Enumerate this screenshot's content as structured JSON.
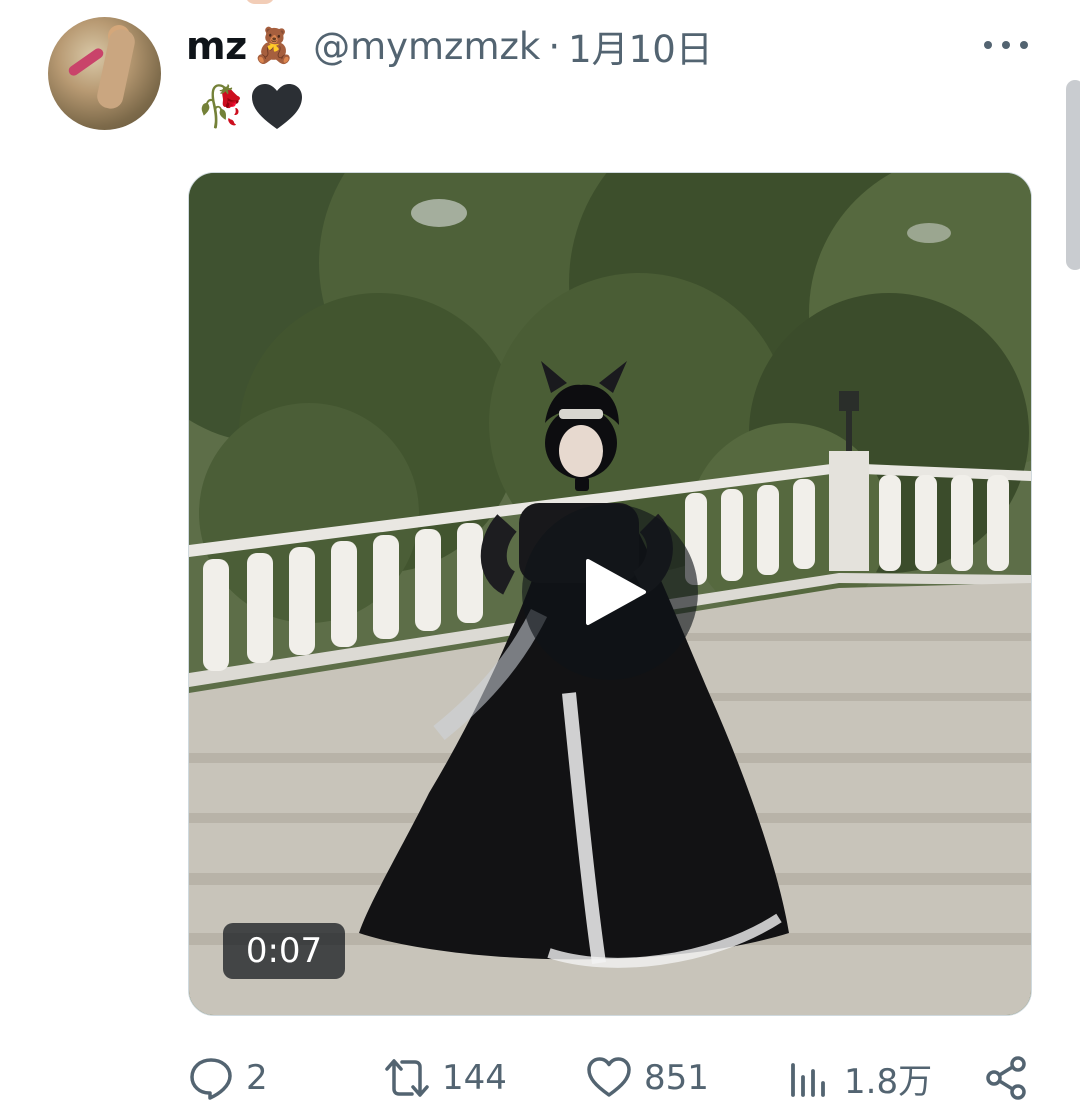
{
  "tweet": {
    "display_name": "mz",
    "name_emoji": "🧸",
    "handle": "@mymzmzk",
    "separator": "·",
    "time": "1月10日",
    "text_emoji_1": "🥀",
    "text_emoji_2_icon": "black-heart-icon",
    "more_icon": "more-horizontal-icon"
  },
  "media": {
    "type": "video",
    "duration": "0:07",
    "play_icon": "play-icon"
  },
  "actions": {
    "reply_count": "2",
    "retweet_count": "144",
    "like_count": "851",
    "views_count": "1.8万",
    "reply_icon": "reply-icon",
    "retweet_icon": "retweet-icon",
    "like_icon": "heart-icon",
    "views_icon": "views-chart-icon",
    "share_icon": "share-icon"
  },
  "colors": {
    "primary_text": "#0f1419",
    "secondary_text": "#536471",
    "border": "#cfd9de"
  }
}
